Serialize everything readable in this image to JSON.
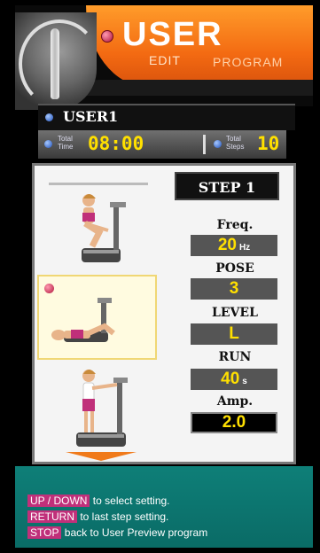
{
  "header": {
    "title": "USER",
    "sub_left": "EDIT",
    "sub_right": "PROGRAM"
  },
  "user": {
    "name": "USER1"
  },
  "stats": {
    "time_label": [
      "Total",
      "Time"
    ],
    "time_value": "08:00",
    "steps_label": [
      "Total",
      "Steps"
    ],
    "steps_value": "10"
  },
  "step": {
    "label": "STEP 1"
  },
  "params": {
    "freq": {
      "label": "Freq.",
      "value": "20",
      "unit": "Hz"
    },
    "pose": {
      "label": "POSE",
      "value": "3"
    },
    "level": {
      "label": "LEVEL",
      "value": "L"
    },
    "run": {
      "label": "RUN",
      "value": "40",
      "unit": "s"
    },
    "amp": {
      "label": "Amp.",
      "value": "2.0"
    }
  },
  "footer": {
    "line1": {
      "key1": "UP",
      "sep": " / ",
      "key2": "DOWN",
      "text": " to select setting."
    },
    "line2": {
      "key": "RETURN",
      "text": " to last step setting."
    },
    "line3": {
      "key": "STOP",
      "text": " back to User Preview program"
    }
  },
  "colors": {
    "accent": "#f36a12",
    "value_yellow": "#ffe000",
    "footer_teal": "#0e7f78",
    "key_magenta": "#c0307a"
  }
}
